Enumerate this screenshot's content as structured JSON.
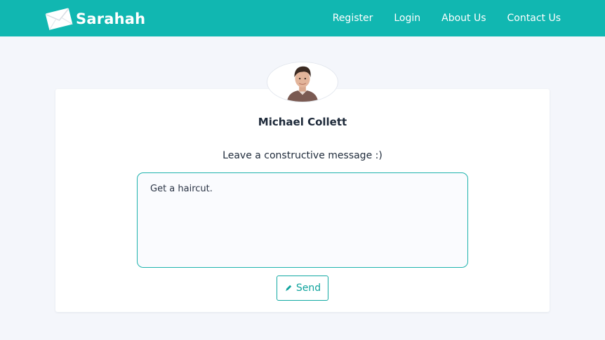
{
  "brand": {
    "name": "Sarahah",
    "logo_icon": "envelope-icon"
  },
  "nav": {
    "items": [
      {
        "label": "Register"
      },
      {
        "label": "Login"
      },
      {
        "label": "About Us"
      },
      {
        "label": "Contact Us"
      }
    ]
  },
  "profile": {
    "name": "Michael Collett",
    "avatar_icon": "user-avatar"
  },
  "form": {
    "prompt": "Leave a constructive message :)",
    "message_value": "Get a haircut.",
    "send_label": "Send",
    "send_icon": "pencil-icon"
  },
  "colors": {
    "accent": "#11b7b1",
    "background": "#f4f6fb",
    "text": "#1e2a3a"
  }
}
